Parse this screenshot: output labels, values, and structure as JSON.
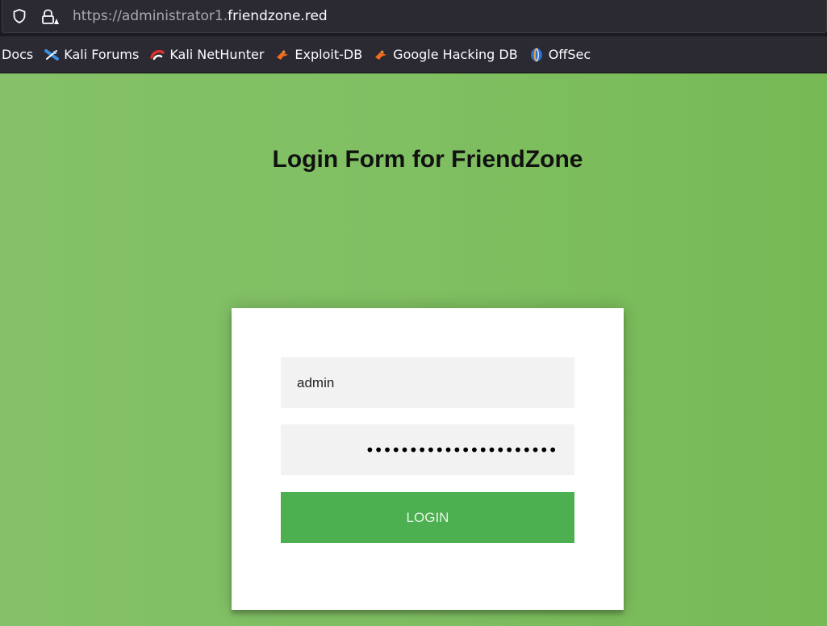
{
  "browser": {
    "url_prefix": "https://administrator1.",
    "url_domain": "friendzone.red",
    "bookmarks": [
      {
        "label": "Docs",
        "icon": ""
      },
      {
        "label": "Kali Forums",
        "icon": "kali-forums-icon"
      },
      {
        "label": "Kali NetHunter",
        "icon": "kali-nethunter-icon"
      },
      {
        "label": "Exploit-DB",
        "icon": "exploit-db-icon"
      },
      {
        "label": "Google Hacking DB",
        "icon": "google-hacking-db-icon"
      },
      {
        "label": "OffSec",
        "icon": "offsec-icon"
      }
    ]
  },
  "page": {
    "title": "Login Form for FriendZone",
    "username_value": "admin",
    "password_mask": "••••••••••••••••••••••",
    "login_label": "LOGIN"
  },
  "colors": {
    "background_green": "#80bf62",
    "button_green": "#4caf50",
    "field_gray": "#f2f2f2"
  }
}
